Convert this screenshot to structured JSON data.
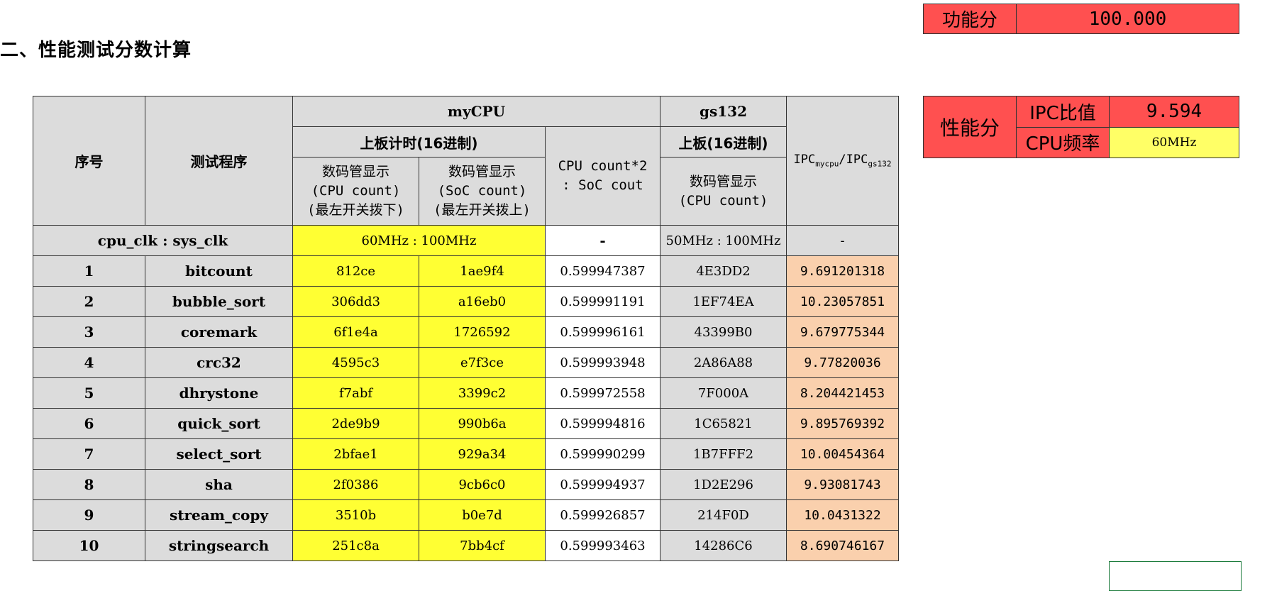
{
  "heading": "二、性能测试分数计算",
  "function_score": {
    "label": "功能分",
    "value": "100.000"
  },
  "performance_score": {
    "label": "性能分",
    "ipc_label": "IPC比值",
    "ipc_value": "9.594",
    "freq_label": "CPU频率",
    "freq_value": "60MHz"
  },
  "table": {
    "col_seq": "序号",
    "col_program": "测试程序",
    "group_mycpu": "myCPU",
    "group_gs132": "gs132",
    "mycpu_timer": "上板计时(16进制)",
    "gs132_timer": "上板(16进制)",
    "col_cpu_count": [
      "数码管显示",
      "(CPU count)",
      "(最左开关拨下)"
    ],
    "col_soc_count": [
      "数码管显示",
      "(SoC count)",
      "(最左开关拨上)"
    ],
    "col_ratio": [
      "CPU count*2",
      ": SoC cout"
    ],
    "col_gs_count": [
      "数码管显示",
      "(CPU count)"
    ],
    "col_ipc_main": "IPC",
    "col_ipc_sub1": "mycpu",
    "col_ipc_sep": "/IPC",
    "col_ipc_sub2": "gs132",
    "clk_label": "cpu_clk : sys_clk",
    "clk_mycpu": "60MHz : 100MHz",
    "clk_ratio": "-",
    "clk_gs132": "50MHz : 100MHz",
    "clk_ipc": "-",
    "rows": [
      {
        "seq": "1",
        "name": "bitcount",
        "cpu": "812ce",
        "soc": "1ae9f4",
        "ratio": "0.599947387",
        "gs": "4E3DD2",
        "ipc": "9.691201318"
      },
      {
        "seq": "2",
        "name": "bubble_sort",
        "cpu": "306dd3",
        "soc": "a16eb0",
        "ratio": "0.599991191",
        "gs": "1EF74EA",
        "ipc": "10.23057851"
      },
      {
        "seq": "3",
        "name": "coremark",
        "cpu": "6f1e4a",
        "soc": "1726592",
        "ratio": "0.599996161",
        "gs": "43399B0",
        "ipc": "9.679775344"
      },
      {
        "seq": "4",
        "name": "crc32",
        "cpu": "4595c3",
        "soc": "e7f3ce",
        "ratio": "0.599993948",
        "gs": "2A86A88",
        "ipc": "9.77820036"
      },
      {
        "seq": "5",
        "name": "dhrystone",
        "cpu": "f7abf",
        "soc": "3399c2",
        "ratio": "0.599972558",
        "gs": "7F000A",
        "ipc": "8.204421453"
      },
      {
        "seq": "6",
        "name": "quick_sort",
        "cpu": "2de9b9",
        "soc": "990b6a",
        "ratio": "0.599994816",
        "gs": "1C65821",
        "ipc": "9.895769392"
      },
      {
        "seq": "7",
        "name": "select_sort",
        "cpu": "2bfae1",
        "soc": "929a34",
        "ratio": "0.599990299",
        "gs": "1B7FFF2",
        "ipc": "10.00454364"
      },
      {
        "seq": "8",
        "name": "sha",
        "cpu": "2f0386",
        "soc": "9cb6c0",
        "ratio": "0.599994937",
        "gs": "1D2E296",
        "ipc": "9.93081743"
      },
      {
        "seq": "9",
        "name": "stream_copy",
        "cpu": "3510b",
        "soc": "b0e7d",
        "ratio": "0.599926857",
        "gs": "214F0D",
        "ipc": "10.0431322"
      },
      {
        "seq": "10",
        "name": "stringsearch",
        "cpu": "251c8a",
        "soc": "7bb4cf",
        "ratio": "0.599993463",
        "gs": "14286C6",
        "ipc": "8.690746167"
      }
    ]
  },
  "colors": {
    "score_red": "#ff5050",
    "yellow": "#ffff33",
    "header_gray": "#dcdcdc",
    "peach": "#fad0ad"
  }
}
